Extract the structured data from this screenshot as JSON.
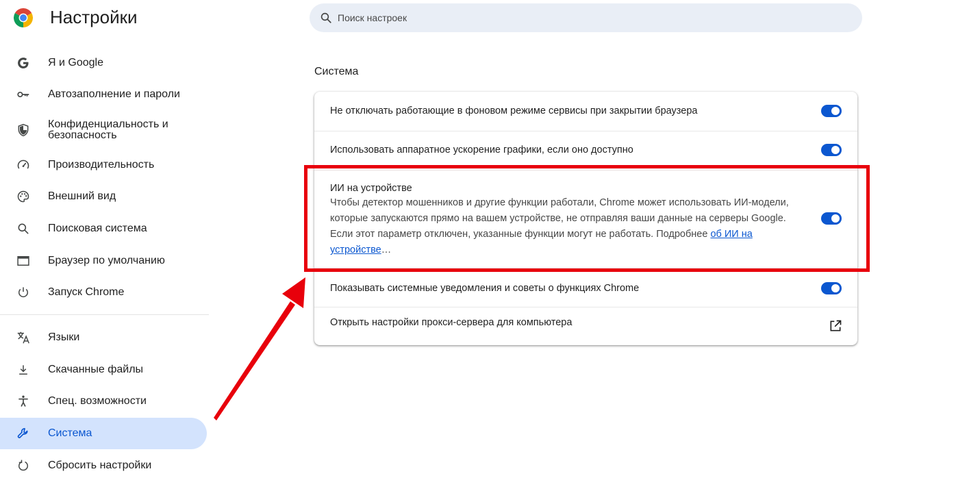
{
  "app": {
    "title": "Настройки",
    "logo_icon": "chrome-logo-icon"
  },
  "search": {
    "placeholder": "Поиск настроек",
    "icon": "search-icon"
  },
  "sidebar": {
    "items": [
      {
        "label": "Я и Google",
        "icon": "google-g-icon",
        "active": false
      },
      {
        "label": "Автозаполнение и пароли",
        "icon": "key-icon",
        "active": false
      },
      {
        "label": "Конфиденциальность и безопасность",
        "icon": "shield-icon",
        "active": false
      },
      {
        "label": "Производительность",
        "icon": "speedometer-icon",
        "active": false
      },
      {
        "label": "Внешний вид",
        "icon": "palette-icon",
        "active": false
      },
      {
        "label": "Поисковая система",
        "icon": "search-icon",
        "active": false
      },
      {
        "label": "Браузер по умолчанию",
        "icon": "browser-window-icon",
        "active": false
      },
      {
        "label": "Запуск Chrome",
        "icon": "power-icon",
        "active": false
      },
      {
        "label": "Языки",
        "icon": "translate-icon",
        "active": false
      },
      {
        "label": "Скачанные файлы",
        "icon": "download-icon",
        "active": false
      },
      {
        "label": "Спец. возможности",
        "icon": "accessibility-icon",
        "active": false
      },
      {
        "label": "Система",
        "icon": "wrench-icon",
        "active": true
      },
      {
        "label": "Сбросить настройки",
        "icon": "reset-icon",
        "active": false
      }
    ]
  },
  "main": {
    "section_title": "Система",
    "rows": [
      {
        "label": "Не отключать работающие в фоновом режиме сервисы при закрытии браузера",
        "toggle": true
      },
      {
        "label": "Использовать аппаратное ускорение графики, если оно доступно",
        "toggle": true
      },
      {
        "label": "ИИ на устройстве",
        "description": "Чтобы детектор мошенников и другие функции работали, Chrome может использовать ИИ-модели, которые запускаются прямо на вашем устройстве, не отправляя ваши данные на серверы Google. Если этот параметр отключен, указанные функции могут не работать. Подробнее ",
        "link_text": "об ИИ на устройстве",
        "link_suffix": "…",
        "toggle": true
      },
      {
        "label": "Показывать системные уведомления и советы о функциях Chrome",
        "toggle": true
      },
      {
        "label": "Открыть настройки прокси-сервера для компьютера",
        "action_icon": "open-in-new-icon"
      }
    ]
  },
  "colors": {
    "accent": "#0b57d0",
    "active_nav_bg": "#d3e3fd",
    "search_bg": "#e9eef6",
    "annotation_red": "#e8000b"
  }
}
